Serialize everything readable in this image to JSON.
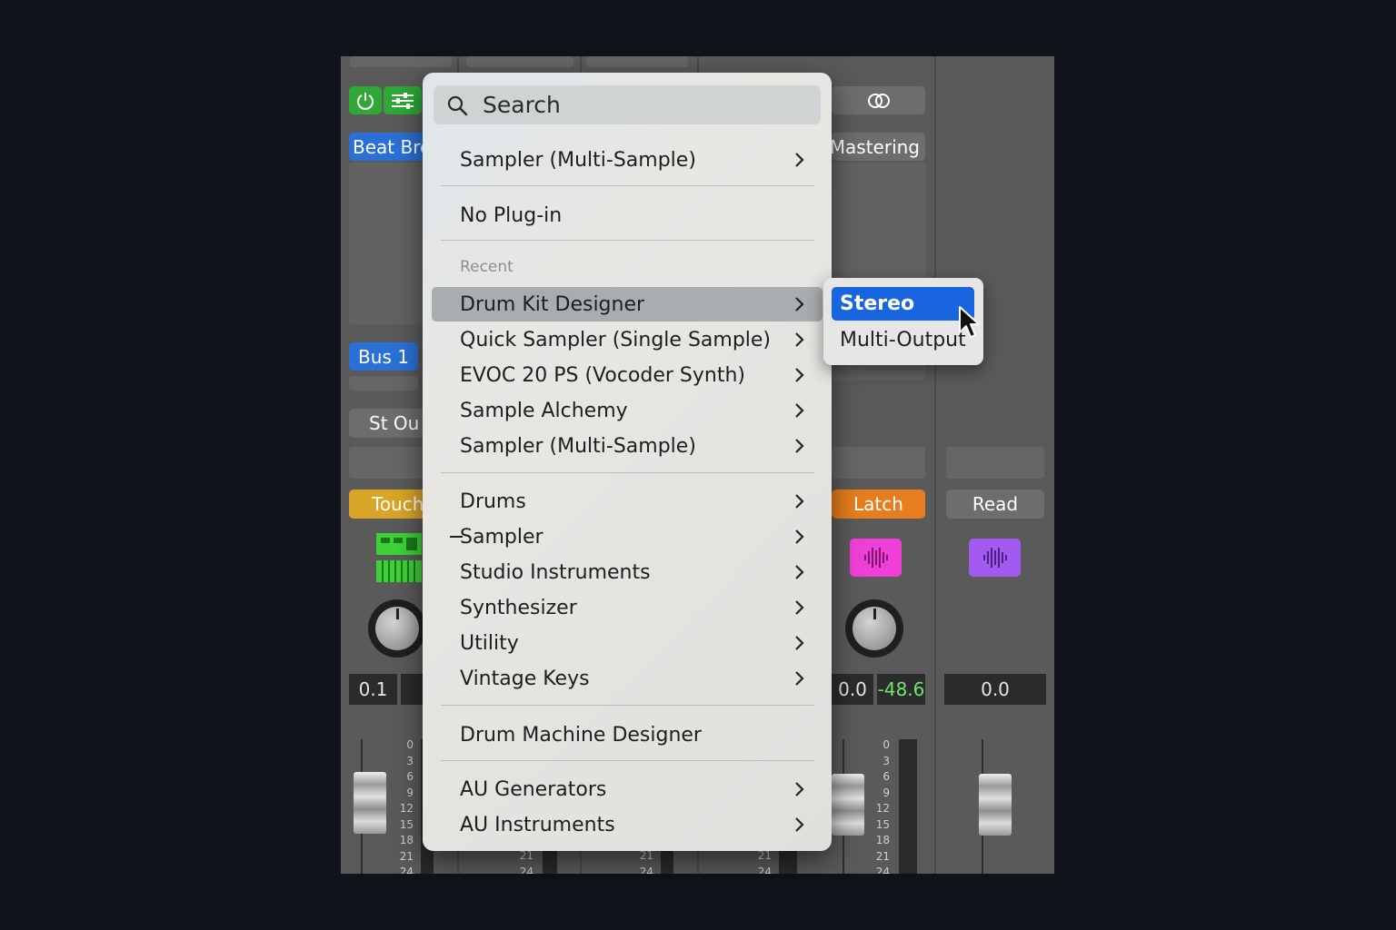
{
  "mixer": {
    "channel_left": {
      "plugin_name": "Beat Bre",
      "bus": "Bus 1",
      "output": "St Ou",
      "automation": "Touch",
      "pan_value": "0.1"
    },
    "channel_right1": {
      "plugin_name": "Mastering",
      "automation": "Latch",
      "pan_value": "0.0",
      "peak_value": "-48.6"
    },
    "channel_right2": {
      "automation": "Read",
      "pan_value": "0.0"
    },
    "meter_scale": [
      "0",
      "3",
      "6",
      "9",
      "12",
      "15",
      "18",
      "21",
      "24"
    ],
    "hidden_scale": [
      "21",
      "24"
    ],
    "colors": {
      "touch": "#d9a526",
      "latch": "#e77d1e",
      "read": "#6d6d6d",
      "bus": "#2a70d6",
      "power": "#2fa836",
      "region_pink": "#f03ed8",
      "region_purple": "#a35af0"
    }
  },
  "menu": {
    "search_placeholder": "Search",
    "top_item": "Sampler (Multi-Sample)",
    "no_plugin": "No Plug-in",
    "recent_header": "Recent",
    "recent_items": [
      "Drum Kit Designer",
      "Quick Sampler (Single Sample)",
      "EVOC 20 PS (Vocoder Synth)",
      "Sample Alchemy",
      "Sampler (Multi-Sample)"
    ],
    "categories": [
      "Drums",
      "Sampler",
      "Studio Instruments",
      "Synthesizer",
      "Utility",
      "Vintage Keys"
    ],
    "drum_machine": "Drum Machine Designer",
    "au_items": [
      "AU Generators",
      "AU Instruments"
    ]
  },
  "submenu": {
    "items": [
      "Stereo",
      "Multi-Output"
    ]
  }
}
